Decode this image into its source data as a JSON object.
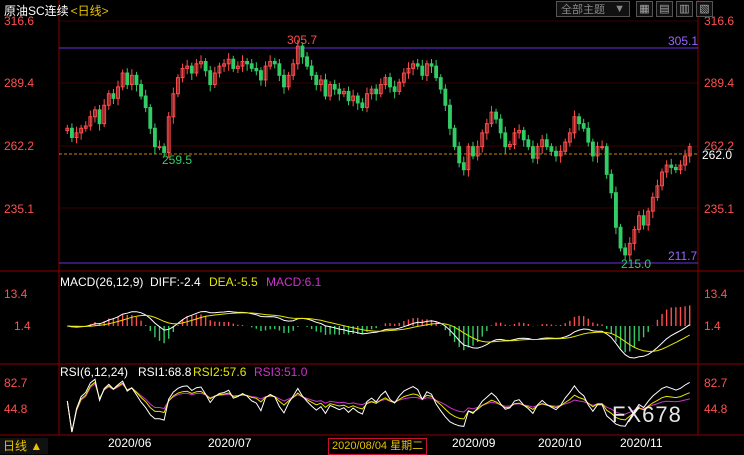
{
  "header": {
    "title": "原油SC连续",
    "period": "<日线>",
    "topic_select": "全部主题",
    "topic_arrow": "▼",
    "buttons": [
      "▦",
      "▤",
      "▥",
      "▧"
    ]
  },
  "price_axis_left": [
    "316.6",
    "289.4",
    "262.2",
    "235.1"
  ],
  "price_axis_right": [
    "316.6",
    "289.4",
    "262.2",
    "235.1"
  ],
  "current_price": "262.0",
  "resistance": {
    "label": "305.1",
    "price": 305.1
  },
  "support": {
    "label": "211.7",
    "price": 211.7
  },
  "marks": {
    "high": "305.7",
    "high_value": 305.7,
    "low_left": "259.5",
    "low_left_value": 259.5,
    "low": "215.0",
    "low_value": 215.0
  },
  "macd": {
    "header": "MACD(26,12,9)",
    "diff": "DIFF:-2.4",
    "dea": "DEA:-5.5",
    "macd": "MACD:6.1",
    "axis": [
      "13.4",
      "1.4"
    ]
  },
  "rsi": {
    "header": "RSI(6,12,24)",
    "rsi1": "RSI1:68.8",
    "rsi2": "RSI2:57.6",
    "rsi3": "RSI3:51.0",
    "axis": [
      "82.7",
      "44.8"
    ]
  },
  "dates": [
    "2020/06",
    "2020/07",
    "2020/09",
    "2020/10",
    "2020/11"
  ],
  "cursor_date": "2020/08/04 星期二",
  "bottom_period": "日线 ▲",
  "watermark": "FX678",
  "colors": {
    "up": "#ff4d4d",
    "down": "#33cc66",
    "purple": "#6a2ee0",
    "yellow": "#e6e600",
    "magenta": "#cc33cc",
    "grid": "#3a0000",
    "axis_text": "#ff5050"
  },
  "closes": [
    270,
    266,
    268,
    270,
    271,
    275,
    278,
    272,
    280,
    285,
    283,
    288,
    294,
    289,
    293,
    289,
    284,
    279,
    270,
    262,
    262,
    259.5,
    275,
    285,
    292,
    296,
    297,
    294,
    298,
    299,
    295,
    289,
    294,
    297,
    298,
    300,
    296,
    297,
    299,
    298,
    296,
    295,
    291,
    297,
    299,
    298,
    293,
    288,
    293,
    298,
    305.7,
    301,
    297,
    293,
    289,
    291,
    284,
    289,
    287,
    285,
    286,
    282,
    284,
    281,
    279,
    285,
    287,
    285,
    289,
    292,
    288,
    286,
    290,
    294,
    296,
    298,
    297,
    293,
    298,
    297,
    292,
    287,
    280,
    270,
    262,
    255,
    252,
    262,
    258,
    262,
    268,
    272,
    277,
    274,
    268,
    262,
    263,
    268,
    269,
    265,
    262,
    257,
    262,
    265,
    262,
    260,
    258,
    260,
    264,
    268,
    275,
    272,
    270,
    264,
    258,
    262,
    262,
    250,
    242,
    227,
    218,
    215,
    220,
    226,
    232,
    228,
    234,
    240,
    245,
    251,
    254,
    253,
    252,
    254,
    258,
    262
  ]
}
